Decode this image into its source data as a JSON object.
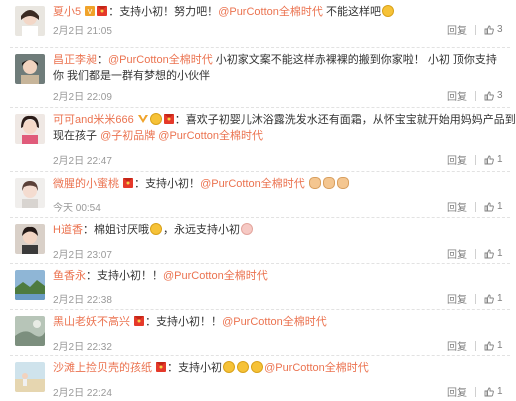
{
  "comments": [
    {
      "user": "夏小5",
      "prefix": "：",
      "text": "支持小初！努力吧！",
      "mention": "@PurCotton全棉时代",
      "suffix": " 不能这样吧",
      "date": "2月2日 21:05",
      "reply": "回复",
      "likes": "3"
    },
    {
      "user": "昌正李昶",
      "prefix": "：",
      "mention1": "@PurCotton全棉时代",
      "text": " 小初家文案不能这样赤裸裸的搬到你家啦！ 小初 顶你支持",
      "line2": "你  我们都是一群有梦想的小伙伴",
      "date": "2月2日 22:09",
      "reply": "回复",
      "likes": "3"
    },
    {
      "user": "可可and米米666",
      "prefix": "：",
      "text": "喜欢子初婴儿沐浴露洗发水还有面霜，从怀宝宝就开始用妈妈产品到",
      "line2a": "现在孩子",
      "mention1": "@子初品牌",
      "mention2": "@PurCotton全棉时代",
      "date": "2月2日 22:47",
      "reply": "回复",
      "likes": "1"
    },
    {
      "user": "微腥的小蜜桃",
      "prefix": "：",
      "text": "支持小初！",
      "mention": "@PurCotton全棉时代",
      "date": "今天 00:54",
      "reply": "回复",
      "likes": "1"
    },
    {
      "user": "H道香",
      "prefix": "：",
      "text": "棉姐讨厌哦",
      "text2": "，永远支持小初",
      "date": "2月2日 23:07",
      "reply": "回复",
      "likes": "1"
    },
    {
      "user": "鱼香永",
      "prefix": "：",
      "text": "支持小初！！",
      "mention": "@PurCotton全棉时代",
      "date": "2月2日 22:38",
      "reply": "回复",
      "likes": "1"
    },
    {
      "user": "黑山老妖不高兴",
      "prefix": "：",
      "text": "支持小初！！",
      "mention": "@PurCotton全棉时代",
      "date": "2月2日 22:32",
      "reply": "回复",
      "likes": "1"
    },
    {
      "user": "沙滩上捡贝壳的孩纸",
      "prefix": "：",
      "text": "支持小初",
      "mention": "@PurCotton全棉时代",
      "date": "2月2日 22:24",
      "reply": "回复",
      "likes": "1"
    }
  ],
  "colors": {
    "username": "#eb7350",
    "meta": "#999999",
    "separator": "#e2e2e2"
  },
  "icons": {
    "vip_badge": "red-envelope-icon",
    "like": "thumbs-up-icon",
    "laugh": "laugh-emoji-icon",
    "sad": "sad-emoji-icon",
    "hand": "victory-hand-emoji-icon"
  }
}
